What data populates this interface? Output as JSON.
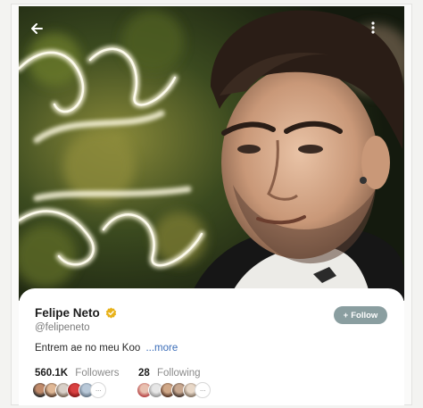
{
  "profile": {
    "name": "Felipe Neto",
    "handle": "@felipeneto",
    "bio": "Entrem ae no meu Koo",
    "bio_more": "...more",
    "follow_label": "Follow",
    "follow_plus": "+"
  },
  "stats": {
    "followers_count": "560.1K",
    "followers_label": "Followers",
    "following_count": "28",
    "following_label": "Following",
    "more_avatars": "···"
  },
  "icons": {
    "back": "arrow-left-icon",
    "more": "more-vertical-icon",
    "verified": "verified-badge-icon"
  },
  "colors": {
    "follow_button": "#8a9ea0",
    "link": "#3b6db8",
    "verified": "#e8b21a"
  }
}
